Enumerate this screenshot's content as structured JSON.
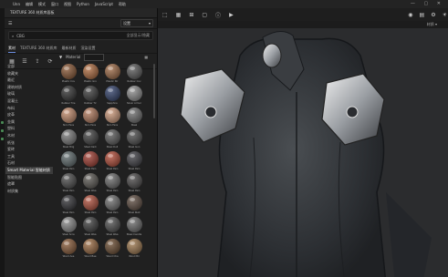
{
  "menu": [
    "Unn",
    "编辑",
    "模式",
    "窗口",
    "视图",
    "Python",
    "JavaScript",
    "帮助"
  ],
  "panel": {
    "title": "TEXTURE 360 材质库面板",
    "dropdown": "设置",
    "search_value": "CBG",
    "search_hint": "全部显示/隐藏",
    "tabs": [
      "素材",
      "TEXTURE 360 材质库",
      "最新材质",
      "渲染设置"
    ],
    "filter_label": "Material"
  },
  "categories": [
    "全部",
    "收藏夹",
    "最近",
    "建筑材质",
    "玻璃",
    "混凝土",
    "布料",
    "皮革",
    "金属",
    "塑料",
    "木材",
    "纸张",
    "瓷砖",
    "工具",
    "石材",
    "Smart Material 智能材质",
    "智能贴图",
    "遮罩",
    "材质集"
  ],
  "materials": [
    {
      "name": "Plastic Cov",
      "color": "#8a5632"
    },
    {
      "name": "Plastic Gro",
      "color": "#b26c3e"
    },
    {
      "name": "Plastic Str",
      "color": "#a06a44"
    },
    {
      "name": "Rubber Cov",
      "color": "#5a5a5a"
    },
    {
      "name": "Rubber Tire",
      "color": "#2f2f2f"
    },
    {
      "name": "Rubber Tir",
      "color": "#3a3a3a"
    },
    {
      "name": "Sapphire",
      "color": "#2f3f6a"
    },
    {
      "name": "Silver Armor",
      "color": "#8f8f8f"
    },
    {
      "name": "Skin Face",
      "color": "#c48b6a"
    },
    {
      "name": "Skin Face",
      "color": "#b57a5c"
    },
    {
      "name": "Skin Face",
      "color": "#d09a7a"
    },
    {
      "name": "Steel",
      "color": "#6e6e6e"
    },
    {
      "name": "Steel Brig",
      "color": "#7a7a7a"
    },
    {
      "name": "Steel Dark",
      "color": "#3e3e3e"
    },
    {
      "name": "Steel Dull",
      "color": "#5a5a5a"
    },
    {
      "name": "Steel Gun",
      "color": "#4c4c4c"
    },
    {
      "name": "Steel Pain",
      "color": "#5e6a6c"
    },
    {
      "name": "Steel Pain",
      "color": "#a23a2e"
    },
    {
      "name": "Steel Pain",
      "color": "#b54a35"
    },
    {
      "name": "Steel Pain",
      "color": "#3e3e44"
    },
    {
      "name": "Steel Pain",
      "color": "#4a4a4a"
    },
    {
      "name": "Steel Wea",
      "color": "#5a5752"
    },
    {
      "name": "Steel Pain",
      "color": "#6a6a6a"
    },
    {
      "name": "Steel Pain",
      "color": "#4a4848"
    },
    {
      "name": "Steel Pain",
      "color": "#2f2f33"
    },
    {
      "name": "Steel Pain",
      "color": "#b24e3a"
    },
    {
      "name": "Steel Pain",
      "color": "#6f6f6f"
    },
    {
      "name": "Steel Rust",
      "color": "#5c4a3e"
    },
    {
      "name": "Steel Scra",
      "color": "#8a8a8a"
    },
    {
      "name": "Steel Wea",
      "color": "#3c3c3c"
    },
    {
      "name": "Steel Wea",
      "color": "#4e4e4e"
    },
    {
      "name": "Steel Candle",
      "color": "#6b6b6b"
    },
    {
      "name": "Wood Ave",
      "color": "#8a5a36"
    },
    {
      "name": "Wood Bee",
      "color": "#9c6a40"
    },
    {
      "name": "Wood Cha",
      "color": "#6a4a2e"
    },
    {
      "name": "Wood Bir",
      "color": "#a0784c"
    }
  ],
  "viewport": {
    "toolbar_icons": [
      "crop-icon",
      "grid-icon",
      "layout-icon",
      "frame-icon",
      "info-icon",
      "play-icon"
    ],
    "right_icons": [
      "camera-icon",
      "layers-icon",
      "settings-icon",
      "light-icon"
    ],
    "dropdown": "材质"
  }
}
